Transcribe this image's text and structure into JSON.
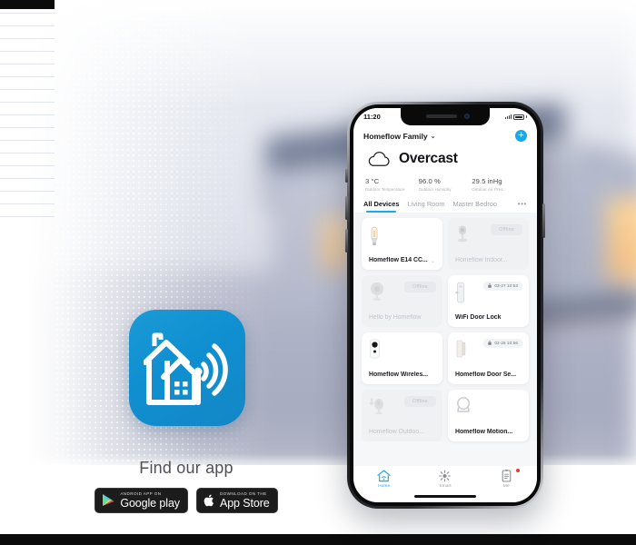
{
  "promo": {
    "find_app_title": "Find our app",
    "badges": [
      {
        "name": "google-play",
        "small": "ANDROID APP ON",
        "big": "Google play",
        "icon": "play-triangle-icon"
      },
      {
        "name": "app-store",
        "small": "Download on the",
        "big": "App Store",
        "icon": "apple-logo-icon"
      }
    ],
    "app_icon_name": "homeflow-app-icon"
  },
  "phone": {
    "status_bar": {
      "time": "11:20",
      "signal": "signal-icon",
      "battery": "battery-icon"
    },
    "header": {
      "family_name": "Homeflow Family",
      "chevron": "⌄",
      "add_label": "+",
      "weather": "Overcast",
      "weather_icon": "cloud-icon"
    },
    "stats": [
      {
        "value": "3 °C",
        "label": "Outdoor Temperature"
      },
      {
        "value": "96.0 %",
        "label": "Outdoor Humidity"
      },
      {
        "value": "29.5 inHg",
        "label": "Outdoor Air Pres."
      }
    ],
    "tabs": [
      {
        "label": "All Devices",
        "active": true
      },
      {
        "label": "Living Room",
        "active": false
      },
      {
        "label": "Master Bedroo",
        "active": false
      }
    ],
    "tabs_more": "•••",
    "devices": [
      {
        "name": "Homeflow E14 CC...",
        "icon": "light-bulb-icon",
        "offline": false,
        "status": "",
        "time": "",
        "chevron": true
      },
      {
        "name": "Homeflow Indoor...",
        "icon": "indoor-camera-icon",
        "offline": true,
        "status": "Offline",
        "time": "",
        "chevron": false
      },
      {
        "name": "Hello by Homeflow",
        "icon": "round-camera-icon",
        "offline": true,
        "status": "Offline",
        "time": "",
        "chevron": false
      },
      {
        "name": "WiFi Door Lock",
        "icon": "door-lock-icon",
        "offline": false,
        "status": "",
        "time": "03-27 10:53",
        "chevron": false
      },
      {
        "name": "Homeflow Wireles...",
        "icon": "wireless-button-icon",
        "offline": false,
        "status": "",
        "time": "",
        "chevron": false
      },
      {
        "name": "Homeflow Door Se...",
        "icon": "door-sensor-icon",
        "offline": false,
        "status": "",
        "time": "02-26 10:56",
        "chevron": false
      },
      {
        "name": "Homeflow Outdoo...",
        "icon": "outdoor-camera-icon",
        "offline": true,
        "status": "Offline",
        "time": "",
        "chevron": false
      },
      {
        "name": "Homeflow Motion...",
        "icon": "motion-sensor-icon",
        "offline": false,
        "status": "",
        "time": "",
        "chevron": false
      }
    ],
    "tabbar": [
      {
        "label": "Home",
        "icon": "home-wifi-icon",
        "active": true,
        "badge": false
      },
      {
        "label": "Smart",
        "icon": "smart-star-icon",
        "active": false,
        "badge": false
      },
      {
        "label": "Me",
        "icon": "profile-list-icon",
        "active": false,
        "badge": true
      }
    ]
  },
  "colors": {
    "accent": "#16a9ec",
    "badge_red": "#f0392b",
    "text": "#131417",
    "muted": "#a9abb3"
  }
}
